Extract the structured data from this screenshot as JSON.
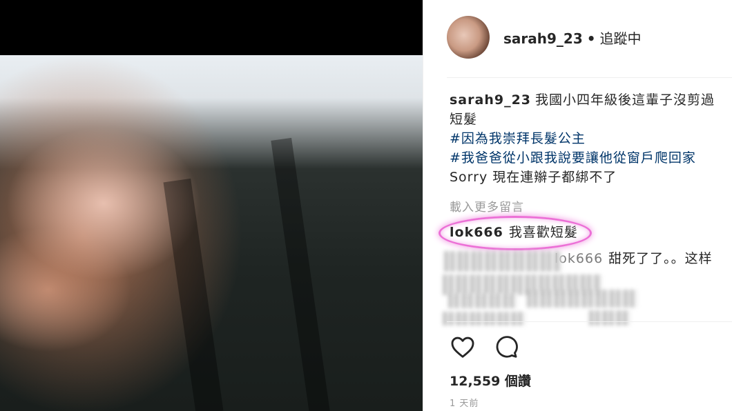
{
  "post": {
    "username": "sarah9_23",
    "separator": "•",
    "follow_status": "追蹤中",
    "caption_user": "sarah9_23",
    "caption_text": "我國小四年級後這輩子沒剪過短髮",
    "hashtags": [
      "#因為我崇拜長髮公主",
      "#我爸爸從小跟我說要讓他從窗戶爬回家"
    ],
    "caption_extra": "Sorry 現在連辮子都綁不了",
    "load_more": "載入更多留言",
    "comments": [
      {
        "user": "lok666",
        "text": "我喜歡短髮"
      },
      {
        "user": "lok666",
        "text": "甜死了了。。这样"
      }
    ],
    "likes": "12,559 個讚",
    "time_ago": "1 天前"
  },
  "icons": {
    "like": "heart-icon",
    "comment": "comment-icon"
  },
  "colors": {
    "hashtag": "#003569",
    "highlight": "#ec6fd6"
  }
}
